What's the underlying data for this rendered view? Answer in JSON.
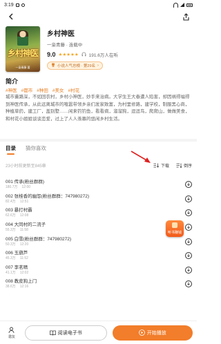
{
  "status_bar": {
    "time": "3:19"
  },
  "book": {
    "title": "乡村神医",
    "meta": "一枭青藤 · 连载中",
    "rating": "9.0",
    "listeners": "191.6万人在听",
    "rank": "小说人气总榜 · 第29名",
    "cover_title": "乡村神医",
    "cover_sub": "一枭青藤 著"
  },
  "synopsis": {
    "heading": "简介",
    "tags": [
      "#神医",
      "#都市",
      "#种田",
      "#美女",
      "#村花"
    ],
    "text": "城市囊路深，不如回农村，乡村小神医，妙手来治病。大学生王大春遭人陷害，却因祸得福得到神医传承，从此远离城市的喧嚣带领乡亲们发家致富，为村里修路，建学校，制服黑心商，种植草药，建工厂，盖别墅……闲来钓钓鱼，看看病，溜溜狗，逗逗鸟，爬爬山，做做美食，和村花小姐姐谈谈恋爱，过上了人人羡慕的悠闲乡村生活。"
  },
  "tabs": [
    {
      "label": "目录"
    },
    {
      "label": "猜你喜欢"
    }
  ],
  "list": {
    "update_info": "23小时前更新至845章",
    "download_label": "下载",
    "order_label": "倒序",
    "episodes": [
      {
        "title": "001 传承(粉丝群群)",
        "plays": "180.7万",
        "duration": "12:00"
      },
      {
        "title": "002 张桂香的幽怨(粉丝群群：747980272)",
        "plays": "82.4万",
        "duration": "12:51"
      },
      {
        "title": "003 暴打村霸",
        "plays": "62.6万",
        "duration": "12:08"
      },
      {
        "title": "004 大同村的二流子",
        "plays": "55.3万",
        "duration": "11:58"
      },
      {
        "title": "005 白雪(粉丝群群：747980272)",
        "plays": "50.3万",
        "duration": "12:20"
      },
      {
        "title": "006 玉葫芦",
        "plays": "45.3万",
        "duration": "11:52"
      },
      {
        "title": "007 李茗晴",
        "plays": "41.1万",
        "duration": "12:02"
      },
      {
        "title": "008 教皮狗上门",
        "plays": "38.6万",
        "duration": "12:16"
      }
    ]
  },
  "float_badge": {
    "label": "听书赚钱"
  },
  "bottom_bar": {
    "share_label": "邀友",
    "read_label": "阅读电子书",
    "play_label": "开始播放"
  },
  "colors": {
    "accent": "#f27d2a",
    "star": "#f5a623",
    "tag": "#e67e22"
  }
}
